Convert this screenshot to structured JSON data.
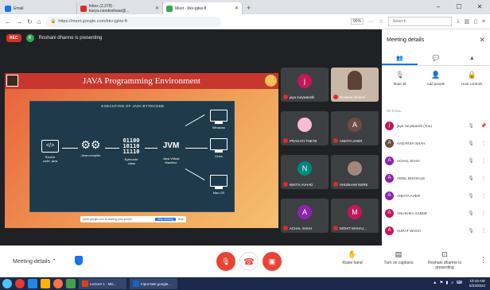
{
  "browser": {
    "tabs": [
      {
        "label": "Email",
        "active": false,
        "color": "#1a73e8"
      },
      {
        "label": "Inbox (2,379) - kavya.nandeshwar@...",
        "active": false,
        "color": "#d93025"
      },
      {
        "label": "Meet - bkv-jgkw-ft",
        "active": true,
        "color": "#34a853"
      }
    ],
    "new_tab": "+",
    "window_controls": [
      "–",
      "☐",
      "✕"
    ],
    "url": "https://meet.google.com/bkv-jgkw-ft",
    "zoom": "90%",
    "search_placeholder": "Search"
  },
  "meet": {
    "rec_label": "REC",
    "presenter_initial": "R",
    "presenter_text": "Roshani dharme is presenting",
    "slide": {
      "title": "JAVA Programming Environment",
      "diagram_title": "EXECUTION OF JAVA BYTECODE",
      "nodes": {
        "source": "Source code .java",
        "compiler": "Java compiler",
        "bytecode": "Bytecode .class",
        "binary": [
          "01100",
          "10110",
          "11110"
        ],
        "jvm": "JVM",
        "jvm_label": "Java Virtual Machine",
        "targets": [
          "Windows",
          "Linux",
          "Mac OS"
        ]
      },
      "share_bar": {
        "text": "meet.google.com is sharing your screen",
        "stop": "Stop sharing",
        "hide": "Hide"
      }
    },
    "tiles": [
      {
        "initial": "j",
        "name": "jaya surywanshi",
        "color": "#c2185b",
        "photo": false
      },
      {
        "initial": "",
        "name": "Roshani dharme",
        "color": "#8d6e63",
        "photo": true
      },
      {
        "initial": "",
        "name": "PRAGATI THETE",
        "color": "#f8bbd0",
        "photo": true
      },
      {
        "initial": "A",
        "name": "ANKITA AHER",
        "color": "#6d4c41",
        "photo": false
      },
      {
        "initial": "N",
        "name": "NIKITA AVHAD",
        "color": "#00897b",
        "photo": false
      },
      {
        "initial": "",
        "name": "SHUBHAM NERE",
        "color": "#a1887f",
        "photo": true
      },
      {
        "initial": "A",
        "name": "ACHAL SHAH",
        "color": "#8e24aa",
        "photo": false
      },
      {
        "initial": "M",
        "name": "MOHIT MAHAJ...",
        "color": "#c2185b",
        "photo": false
      }
    ],
    "bottom": {
      "meeting_details": "Meeting details",
      "raise_hand": "Raise hand",
      "captions": "Turn on captions",
      "presenting": "Roshani dharme is presenting"
    }
  },
  "panel": {
    "title": "Meeting details",
    "tabs": [
      "People",
      "Chat",
      "Activities"
    ],
    "actions": [
      "Mute all",
      "Add people",
      "Host controls"
    ],
    "in_meeting": "IN CALL",
    "people": [
      {
        "initial": "j",
        "name": "jaya surywanshi (You)",
        "color": "#c2185b"
      },
      {
        "initial": "A",
        "name": "AADARSH SHAH",
        "color": "#6d4c41"
      },
      {
        "initial": "A",
        "name": "ACHAL SHAH",
        "color": "#8e24aa"
      },
      {
        "initial": "A",
        "name": "AMOL BHOSALE",
        "color": "#8e24aa"
      },
      {
        "initial": "A",
        "name": "ANKITA AHER",
        "color": "#8e24aa"
      },
      {
        "initial": "A",
        "name": "ANUSHKA SABDE",
        "color": "#c2185b"
      },
      {
        "initial": "A",
        "name": "AURAT WAGH",
        "color": "#c2185b"
      }
    ]
  },
  "taskbar": {
    "apps": [
      "Lecture 1 - Mic...",
      "Input task google..."
    ],
    "time": "10:19 AM",
    "date": "5/23/2022"
  },
  "colors": {
    "record": "#d93025",
    "accent": "#1a73e8",
    "end_call": "#ea4335"
  }
}
